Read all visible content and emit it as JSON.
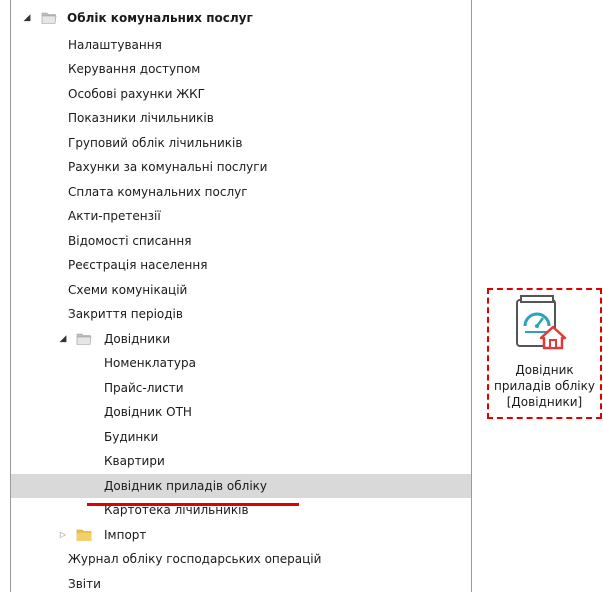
{
  "tree": {
    "root_label": "Облік комунальних послуг",
    "items": [
      "Налаштування",
      "Керування доступом",
      "Особові рахунки ЖКГ",
      "Показники лічильників",
      "Груповий облік лічильників",
      "Рахунки за комунальні послуги",
      "Сплата комунальних послуг",
      "Акти-претензії",
      "Відомості списання",
      "Реєстрація населення",
      "Схеми комунікацій",
      "Закриття періодів"
    ],
    "dovidnyky": {
      "label": "Довідники",
      "items": [
        "Номенклатура",
        "Прайс-листи",
        "Довідник ОТН",
        "Будинки",
        "Квартири",
        "Довідник приладів обліку",
        "Картотека лічильників"
      ]
    },
    "import_label": "Імпорт",
    "tail_items": [
      "Журнал обліку господарських операцій",
      "Звіти"
    ]
  },
  "tile": {
    "line1": "Довідник",
    "line2": "приладів обліку",
    "line3": "[Довідники]"
  },
  "colors": {
    "selection": "#d9d9d9",
    "highlight_red": "#e00000",
    "folder_yellow": "#e8c14e"
  },
  "icons": {
    "expanded_arrow": "◢",
    "collapsed_arrow": "▷"
  }
}
